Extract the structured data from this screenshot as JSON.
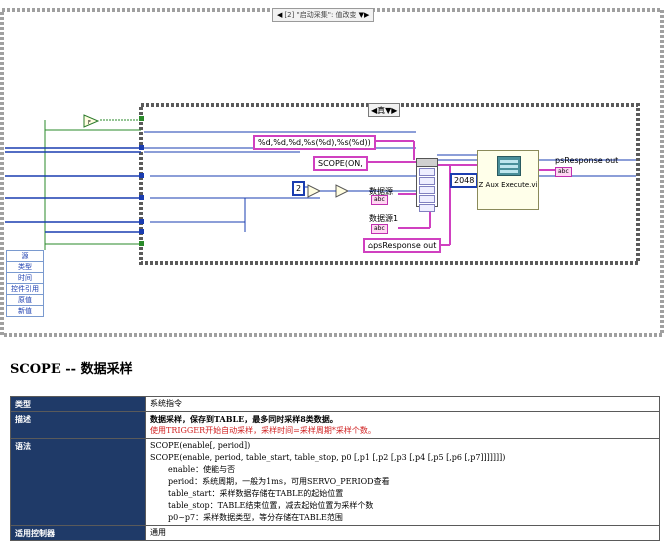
{
  "diagram": {
    "case_selector": "[2] \"启动采集\": 值改变",
    "inner_case_label": "真",
    "format_string": "%d,%d,%d,%s(%d),%s(%d))",
    "scope_string": "SCOPE(ON,",
    "const_2": "2",
    "const_2048": "2048",
    "label_source": "数据源",
    "label_source1": "数据源1",
    "label_psresponse_local": "psResponse out",
    "label_psresponse_out": "psResponse out",
    "indicator_abc": "abc",
    "vi_name": "Z Aux Execute.vi",
    "event_items": [
      "源",
      "类型",
      "时间",
      "控件引用",
      "原值",
      "新值"
    ]
  },
  "doc": {
    "title": "SCOPE -- 数据采样",
    "rows": {
      "type_key": "类型",
      "type_val": "系统指令",
      "desc_key": "描述",
      "desc_line1": "数据采样，保存到TABLE，最多同时采样8类数据。",
      "desc_line2": "使用TRIGGER开始自动采样，采样时间=采样周期*采样个数。",
      "syntax_key": "语法",
      "syntax_lines": [
        "SCOPE(enable[, period])",
        "SCOPE(enable, period, table_start, table_stop, p0 [,p1 [,p2 [,p3 [,p4 [,p5 [,p6 [,p7]]]]]]])",
        "enable：使能与否",
        "period：系统周期，一般为1ms，可用SERVO_PERIOD查看",
        "table_start：采样数据存储在TABLE的起始位置",
        "table_stop：TABLE结束位置，减去起始位置为采样个数",
        "p0~p7：采样数据类型，等分存储在TABLE范围"
      ],
      "ctrl_key": "适用控制器",
      "ctrl_val": "通用"
    }
  }
}
